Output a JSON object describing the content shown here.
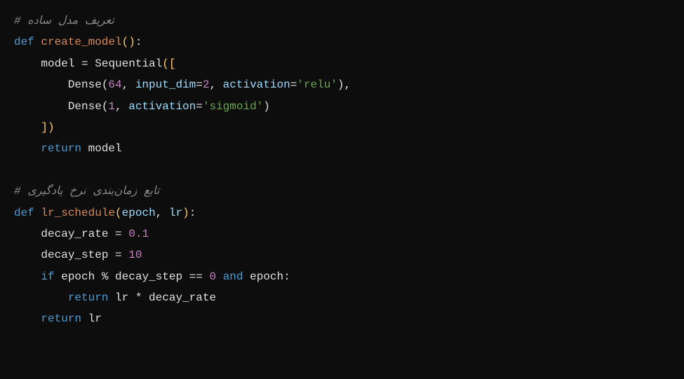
{
  "code": {
    "comment1": "# تعریف مدل ساده",
    "def1": "def",
    "fn1": "create_model",
    "lp1": "(",
    "rp1": ")",
    "colon1": ":",
    "indent1": "    ",
    "indent2": "        ",
    "model": "model",
    "eq": " = ",
    "Sequential": "Sequential",
    "lbr": "([",
    "Dense1": "Dense(",
    "n64": "64",
    "comma": ", ",
    "input_dim": "input_dim",
    "eq2": "=",
    "n2": "2",
    "activation": "activation",
    "relu": "'relu'",
    "rp2": ")",
    "Dense2": "Dense(",
    "n1": "1",
    "sigmoid": "'sigmoid'",
    "rbr": "])",
    "return1": "return",
    "sp": " ",
    "blank": "",
    "comment2": "# تابع زمان‌بندی نرخ یادگیری",
    "def2": "def",
    "fn2": "lr_schedule",
    "epoch": "epoch",
    "lr": "lr",
    "decay_rate": "decay_rate",
    "n01": "0.1",
    "decay_step": "decay_step",
    "n10": "10",
    "if": "if",
    "mod": " % ",
    "eqeq": " == ",
    "n0": "0",
    "and": "and",
    "mult": " * ",
    "return2": "return"
  }
}
